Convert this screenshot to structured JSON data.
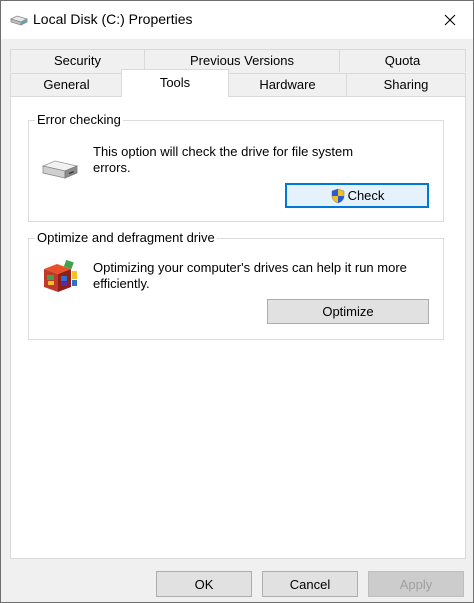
{
  "window": {
    "title": "Local Disk (C:) Properties"
  },
  "tabs": {
    "row1": [
      {
        "label": "Security"
      },
      {
        "label": "Previous Versions"
      },
      {
        "label": "Quota"
      }
    ],
    "row2": [
      {
        "label": "General"
      },
      {
        "label": "Tools",
        "selected": true
      },
      {
        "label": "Hardware"
      },
      {
        "label": "Sharing"
      }
    ]
  },
  "error_checking": {
    "title": "Error checking",
    "description": "This option will check the drive for file system errors.",
    "button_label": "Check",
    "icon": "drive-icon"
  },
  "optimize": {
    "title": "Optimize and defragment drive",
    "description": "Optimizing your computer's drives can help it run more efficiently.",
    "button_label": "Optimize",
    "icon": "defrag-icon"
  },
  "footer": {
    "ok_label": "OK",
    "cancel_label": "Cancel",
    "apply_label": "Apply"
  },
  "colors": {
    "focus_border": "#0078d7",
    "panel_bg": "#ffffff",
    "window_bg": "#f0f0f0"
  }
}
